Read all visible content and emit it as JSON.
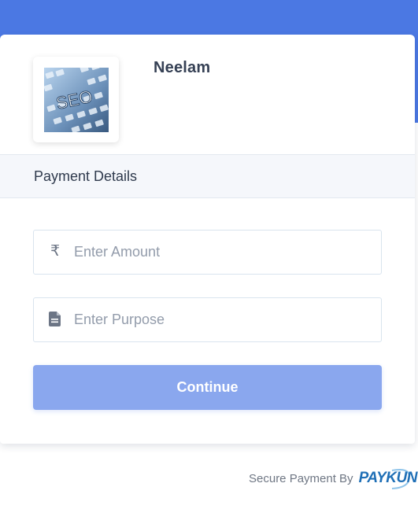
{
  "merchant": {
    "name": "Neelam",
    "logo_text": "SEO"
  },
  "section": {
    "title": "Payment Details"
  },
  "form": {
    "amount": {
      "icon": "rupee-icon",
      "icon_glyph": "₹",
      "placeholder": "Enter Amount",
      "value": ""
    },
    "purpose": {
      "icon": "document-icon",
      "placeholder": "Enter Purpose",
      "value": ""
    },
    "continue_label": "Continue"
  },
  "footer": {
    "secure_text": "Secure Payment By",
    "brand": "PAYKUN"
  },
  "colors": {
    "banner": "#4b78e3",
    "button": "#8aa7ee",
    "brand": "#1f6fb6"
  }
}
